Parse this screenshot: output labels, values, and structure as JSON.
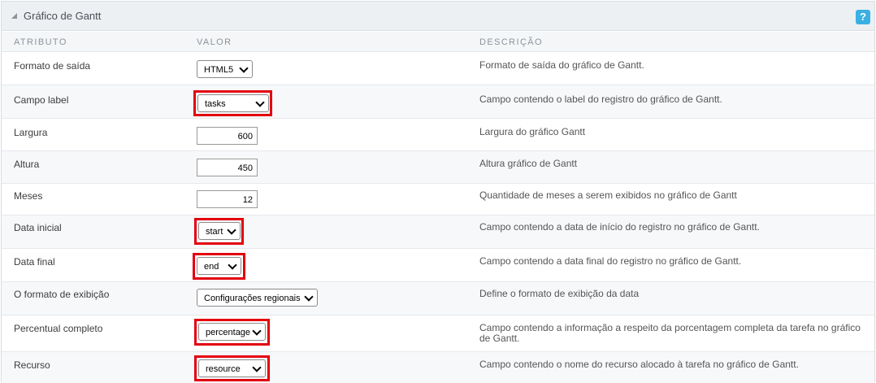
{
  "panel": {
    "title": "Gráfico de Gantt",
    "help_label": "?"
  },
  "columns": {
    "attribute": "ATRIBUTO",
    "value": "VALOR",
    "description": "DESCRIÇÃO"
  },
  "rows": [
    {
      "label": "Formato de saída",
      "control": "select",
      "value": "HTML5",
      "highlighted": false,
      "description": "Formato de saída do gráfico de Gantt."
    },
    {
      "label": "Campo label",
      "control": "select",
      "value": "tasks",
      "highlighted": true,
      "description": "Campo contendo o label do registro do gráfico de Gantt."
    },
    {
      "label": "Largura",
      "control": "input",
      "value": "600",
      "highlighted": false,
      "description": "Largura do gráfico Gantt"
    },
    {
      "label": "Altura",
      "control": "input",
      "value": "450",
      "highlighted": false,
      "description": "Altura gráfico de Gantt"
    },
    {
      "label": "Meses",
      "control": "input",
      "value": "12",
      "highlighted": false,
      "description": "Quantidade de meses a serem exibidos no gráfico de Gantt"
    },
    {
      "label": "Data inicial",
      "control": "select",
      "value": "start",
      "highlighted": true,
      "description": "Campo contendo a data de início do registro no gráfico de Gantt."
    },
    {
      "label": "Data final",
      "control": "select",
      "value": "end",
      "highlighted": true,
      "description": "Campo contendo a data final do registro no gráfico de Gantt."
    },
    {
      "label": "O formato de exibição",
      "control": "select",
      "value": "Configurações regionais",
      "highlighted": false,
      "description": "Define o formato de exibição da data"
    },
    {
      "label": "Percentual completo",
      "control": "select",
      "value": "percentage",
      "highlighted": true,
      "description": "Campo contendo a informação a respeito da porcentagem completa da tarefa no gráfico de Gantt."
    },
    {
      "label": "Recurso",
      "control": "select",
      "value": "resource",
      "highlighted": true,
      "description": "Campo contendo o nome do recurso alocado à tarefa no gráfico de Gantt."
    }
  ],
  "colors": {
    "highlight": "#e3000f",
    "help_accent": "#3ab0e2"
  },
  "icons": {
    "collapse": "collapse-triangle-icon",
    "help": "help-icon"
  }
}
